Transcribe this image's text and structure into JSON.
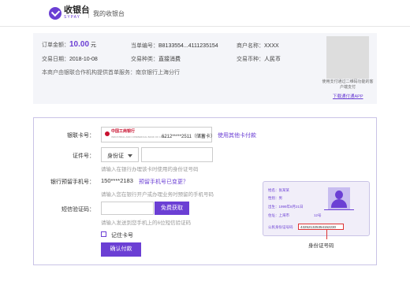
{
  "header": {
    "logo_cn": "收银台",
    "logo_en": "SYPAY",
    "page_title": "我的收银台"
  },
  "order": {
    "amount_label": "订单金额：",
    "amount_value": "10.00",
    "amount_unit": "元",
    "order_no_label": "当单编号：",
    "order_no_value": "B8133554...4111235154",
    "merchant_label": "商户名称：",
    "merchant_value": "XXXX",
    "date_label": "交易日期：",
    "date_value": "2018-10-08",
    "type_label": "交易种类：",
    "type_value": "直接消费",
    "currency_label": "交易币种：",
    "currency_value": "人民币",
    "provider_note": "本商户由银联合作机构提供首单服务：南京银行上海分行",
    "qr_note": "使用支付通过二维码功能的客户端支付",
    "qr_link": "下载通付通APP"
  },
  "form": {
    "card_label": "银联卡号：",
    "bank_name": "中国工商银行",
    "bank_sub": "INDUSTRIAL AND COMMERCIAL BANK OF CHINA",
    "card_number": "6212*****2511（储蓄卡）",
    "other_card_link": "使用其他卡付款",
    "id_label": "证件号：",
    "id_type": "身份证",
    "id_hint": "请输入在银行办理该卡时使用的身份证号码",
    "phone_label": "银行预留手机号：",
    "phone_value": "150****2183",
    "phone_link": "预留手机号已变更？",
    "phone_hint": "请输入您在银行开户或办理业务时预留的手机号码",
    "sms_label": "短信验证码：",
    "sms_button": "免费获取",
    "sms_hint": "请输入发送到您手机上的6位短信验证码",
    "remember_label": "记住卡号",
    "submit_button": "确认付款"
  },
  "idcard": {
    "name_label": "姓名：张某某",
    "gender_label": "性别：男",
    "birth_label": "出生：1999年8月21日",
    "address_label": "住址：上海市",
    "address_suffix": "12号",
    "idno_label": "公民身份证号码",
    "idno_value": "432521325354152230",
    "caption": "身份证号码"
  }
}
